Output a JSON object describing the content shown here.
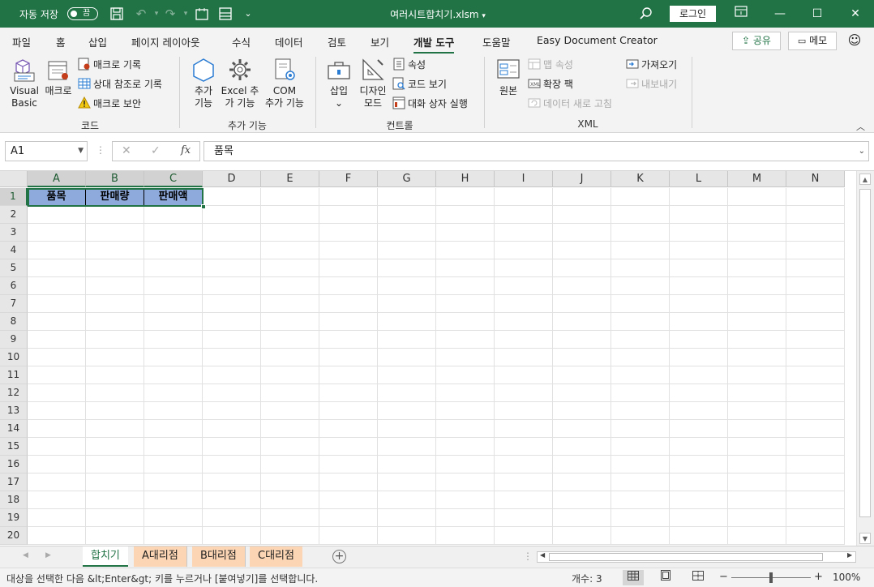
{
  "titlebar": {
    "autosave_label": "자동 저장",
    "autosave_state": "끔",
    "document_title": "여러시트합치기.xlsm",
    "title_dropdown": "▾",
    "login_label": "로그인"
  },
  "ribbon_tabs": [
    "파일",
    "홈",
    "삽입",
    "페이지 레이아웃",
    "수식",
    "데이터",
    "검토",
    "보기",
    "개발 도구",
    "도움말",
    "Easy Document Creator"
  ],
  "active_tab": "개발 도구",
  "share_label": "공유",
  "memo_label": "메모",
  "ribbon": {
    "code": {
      "label": "코드",
      "visual_basic_line1": "Visual",
      "visual_basic_line2": "Basic",
      "macro": "매크로",
      "record_macro": "매크로 기록",
      "relative_ref": "상대 참조로 기록",
      "macro_security": "매크로 보안"
    },
    "addins": {
      "label": "추가 기능",
      "addins_line1": "추가",
      "addins_line2": "기능",
      "excel_addins_line1": "Excel 추",
      "excel_addins_line2": "가 기능",
      "com_addins_line1": "COM",
      "com_addins_line2": "추가 기능"
    },
    "controls": {
      "label": "컨트롤",
      "insert": "삽입",
      "insert_arrow": "⌄",
      "design_line1": "디자인",
      "design_line2": "모드",
      "properties": "속성",
      "view_code": "코드 보기",
      "run_dialog": "대화 상자 실행"
    },
    "xml": {
      "label": "XML",
      "source": "원본",
      "map_properties": "맵 속성",
      "expansion_packs": "확장 팩",
      "refresh_data": "데이터 새로 고침",
      "import": "가져오기",
      "export": "내보내기"
    }
  },
  "formula_bar": {
    "name_box": "A1",
    "formula": "품목",
    "cancel_glyph": "✕",
    "enter_glyph": "✓",
    "fx_glyph": "fx"
  },
  "columns": [
    "A",
    "B",
    "C",
    "D",
    "E",
    "F",
    "G",
    "H",
    "I",
    "J",
    "K",
    "L",
    "M",
    "N"
  ],
  "rows": [
    "1",
    "2",
    "3",
    "4",
    "5",
    "6",
    "7",
    "8",
    "9",
    "10",
    "11",
    "12",
    "13",
    "14",
    "15",
    "16",
    "17",
    "18",
    "19",
    "20"
  ],
  "cells": {
    "A1": "품목",
    "B1": "판매량",
    "C1": "판매액"
  },
  "sheets": [
    {
      "name": "합치기",
      "active": true
    },
    {
      "name": "A대리점",
      "active": false
    },
    {
      "name": "B대리점",
      "active": false
    },
    {
      "name": "C대리점",
      "active": false
    }
  ],
  "add_sheet_glyph": "+",
  "status": {
    "message": "대상을 선택한 다음 &lt;Enter&gt; 키를 누르거나 [붙여넣기]를 선택합니다.",
    "count": "개수: 3",
    "zoom_minus": "−",
    "zoom_plus": "+",
    "zoom": "100%"
  },
  "colors": {
    "brand": "#217346",
    "header_fill": "#8ea9db",
    "sheet_tab_fill": "#fcd5b4"
  }
}
